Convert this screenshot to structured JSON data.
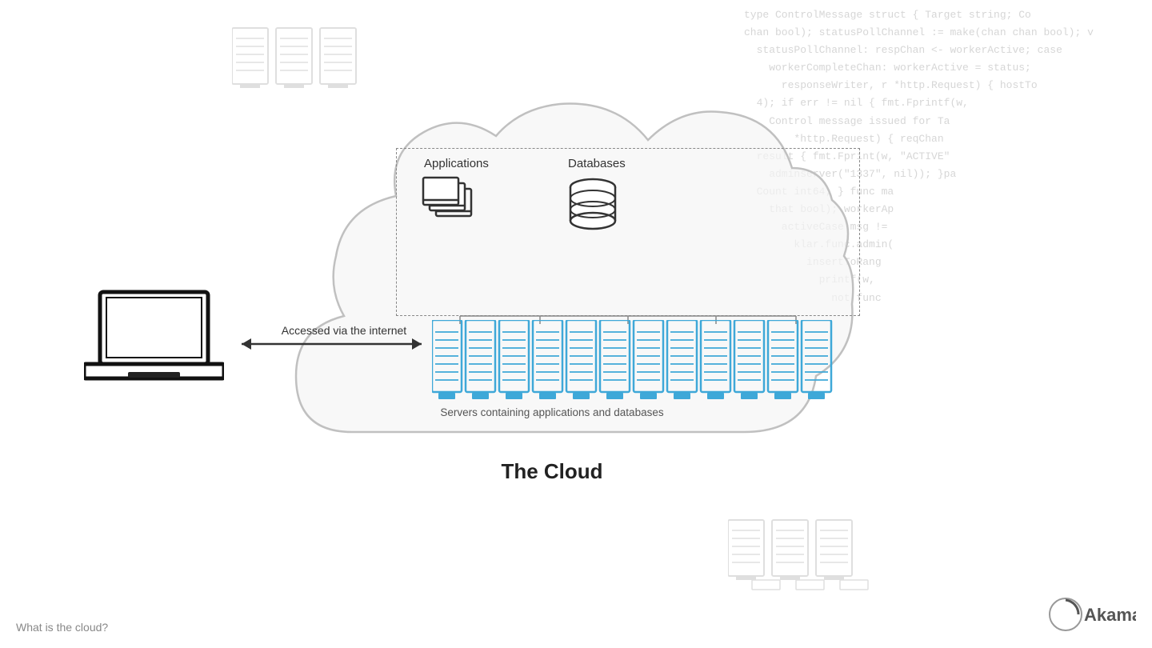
{
  "background_code": "type ControlMessage struct { Target string; Co\nchan bool); statusPollChannel := make(chan chan bool); v\n  statusPollChannel: respChan <- workerActive; case\n    workerCompleteChan: workerActive = status;\n      responseWriter, r *http.Request) { hostTo\n  4); if err != nil { fmt.Fprintf(w,\n    Control message issued for Ta\n        *http.Request) { reqChan\n  result { fmt.Fprint(w, \"ACTIVE\"\n    adminserver(\"1337\", nil)); }pa\n  Count int64; } func ma\n    that bool); workerAp\n      activeCase msg !=\n        klar.func.admin(\n          insertToRang\n            printf(w,\n              not func",
  "labels": {
    "applications": "Applications",
    "databases": "Databases",
    "accessed_via": "Accessed via the internet",
    "servers_label": "Servers containing applications and databases",
    "cloud_title": "The Cloud",
    "bottom_left": "What is the cloud?",
    "akamai": "Akamai"
  },
  "colors": {
    "server_blue": "#3ea8d8",
    "cloud_stroke": "#b0b0b0",
    "laptop_stroke": "#222222",
    "text_dark": "#333333",
    "text_muted": "#888888"
  }
}
